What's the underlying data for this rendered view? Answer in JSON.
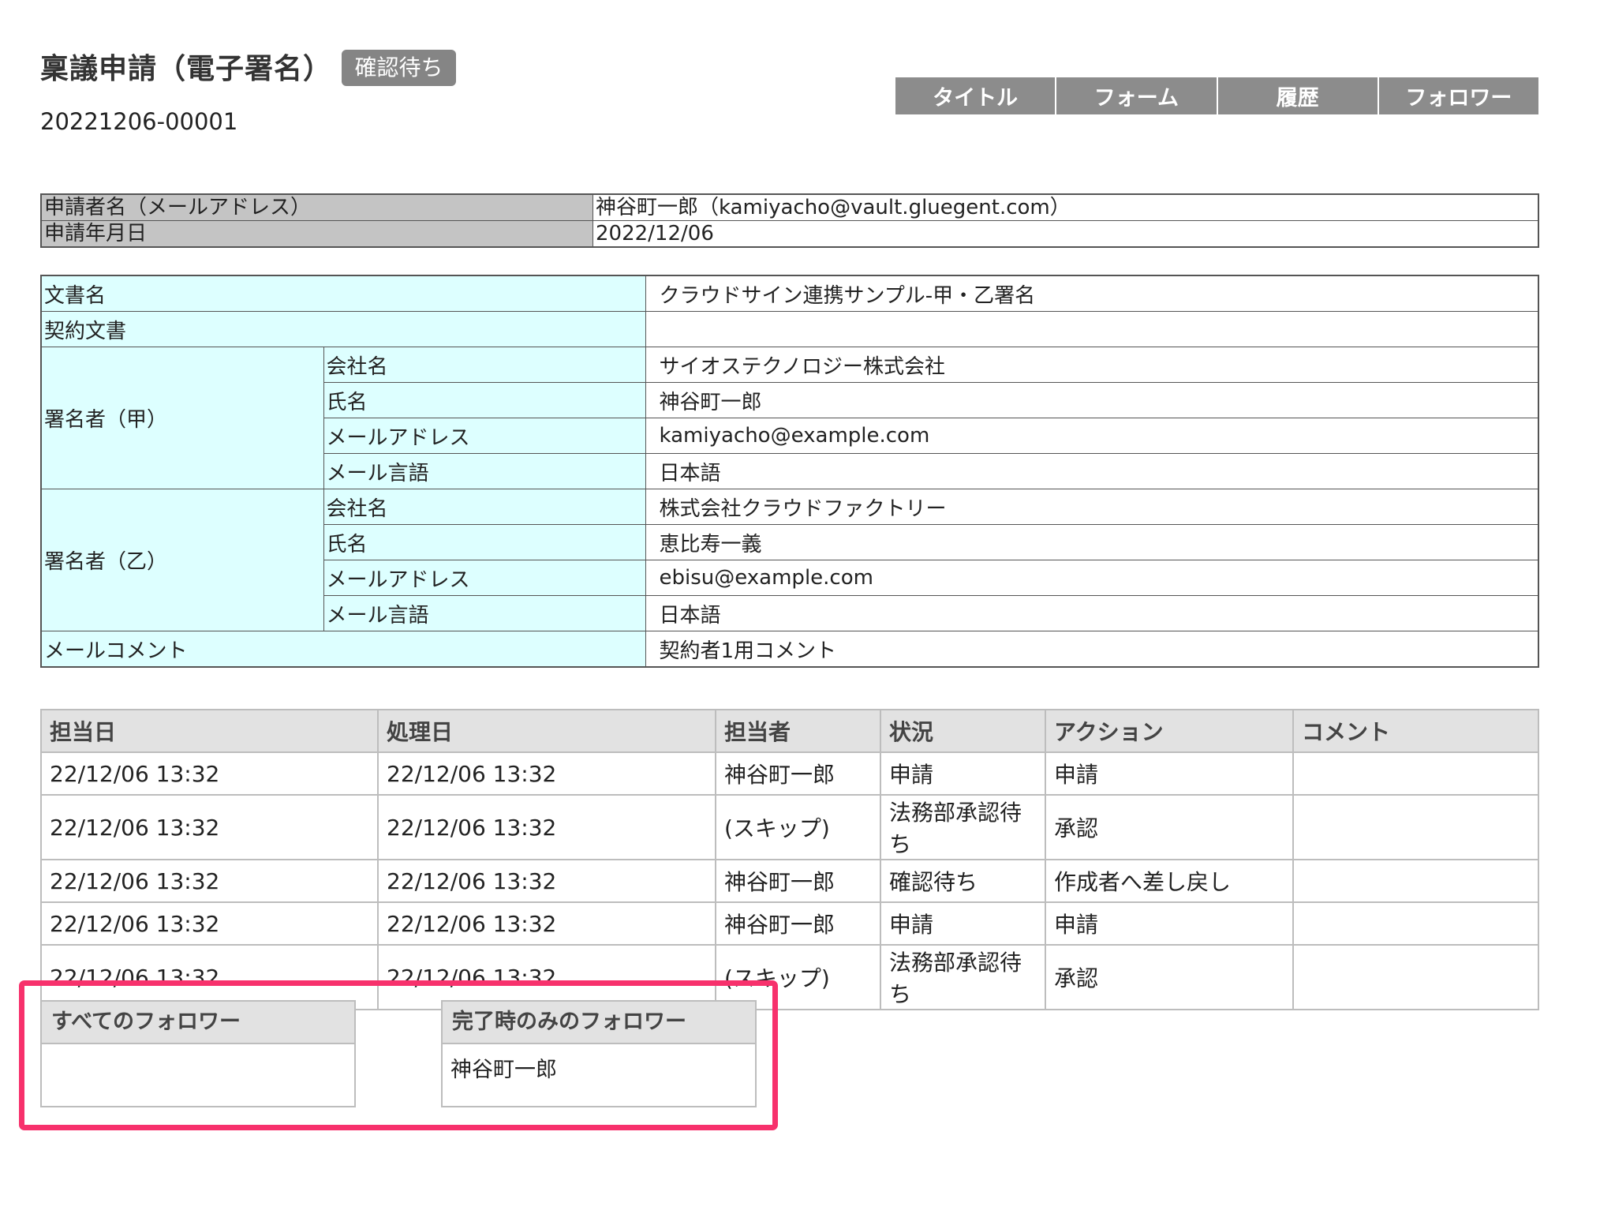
{
  "header": {
    "title": "稟議申請（電子署名）",
    "status_badge": "確認待ち",
    "document_number": "20221206-00001"
  },
  "tabs": [
    "タイトル",
    "フォーム",
    "履歴",
    "フォロワー"
  ],
  "applicant": {
    "rows": [
      {
        "label": "申請者名（メールアドレス）",
        "value": "神谷町一郎（kamiyacho@vault.gluegent.com）"
      },
      {
        "label": "申請年月日",
        "value": "2022/12/06"
      }
    ]
  },
  "form": {
    "doc_name_label": "文書名",
    "doc_name_value": "クラウドサイン連携サンプル-甲・乙署名",
    "contract_label": "契約文書",
    "contract_value": "",
    "signer_a": {
      "label": "署名者（甲）",
      "fields": [
        {
          "label": "会社名",
          "value": "サイオステクノロジー株式会社"
        },
        {
          "label": "氏名",
          "value": "神谷町一郎"
        },
        {
          "label": "メールアドレス",
          "value": "kamiyacho@example.com"
        },
        {
          "label": "メール言語",
          "value": "日本語"
        }
      ]
    },
    "signer_b": {
      "label": "署名者（乙）",
      "fields": [
        {
          "label": "会社名",
          "value": "株式会社クラウドファクトリー"
        },
        {
          "label": "氏名",
          "value": "恵比寿一義"
        },
        {
          "label": "メールアドレス",
          "value": "ebisu@example.com"
        },
        {
          "label": "メール言語",
          "value": "日本語"
        }
      ]
    },
    "mail_comment_label": "メールコメント",
    "mail_comment_value": "契約者1用コメント"
  },
  "history": {
    "headers": [
      "担当日",
      "処理日",
      "担当者",
      "状況",
      "アクション",
      "コメント"
    ],
    "rows": [
      [
        "22/12/06 13:32",
        "22/12/06 13:32",
        "神谷町一郎",
        "申請",
        "申請",
        ""
      ],
      [
        "22/12/06 13:32",
        "22/12/06 13:32",
        "(スキップ)",
        "法務部承認待ち",
        "承認",
        ""
      ],
      [
        "22/12/06 13:32",
        "22/12/06 13:32",
        "神谷町一郎",
        "確認待ち",
        "作成者へ差し戻し",
        ""
      ],
      [
        "22/12/06 13:32",
        "22/12/06 13:32",
        "神谷町一郎",
        "申請",
        "申請",
        ""
      ],
      [
        "22/12/06 13:32",
        "22/12/06 13:32",
        "(スキップ)",
        "法務部承認待ち",
        "承認",
        ""
      ]
    ]
  },
  "followers": {
    "all_label": "すべてのフォロワー",
    "all_value": "",
    "completion_label": "完了時のみのフォロワー",
    "completion_value": "神谷町一郎"
  },
  "colors": {
    "highlight": "#f7316c",
    "tab_bg": "#8c8c8c",
    "label_bg": "#ddffff",
    "applicant_label_bg": "#c4c4c4",
    "badge_bg": "#858585"
  }
}
